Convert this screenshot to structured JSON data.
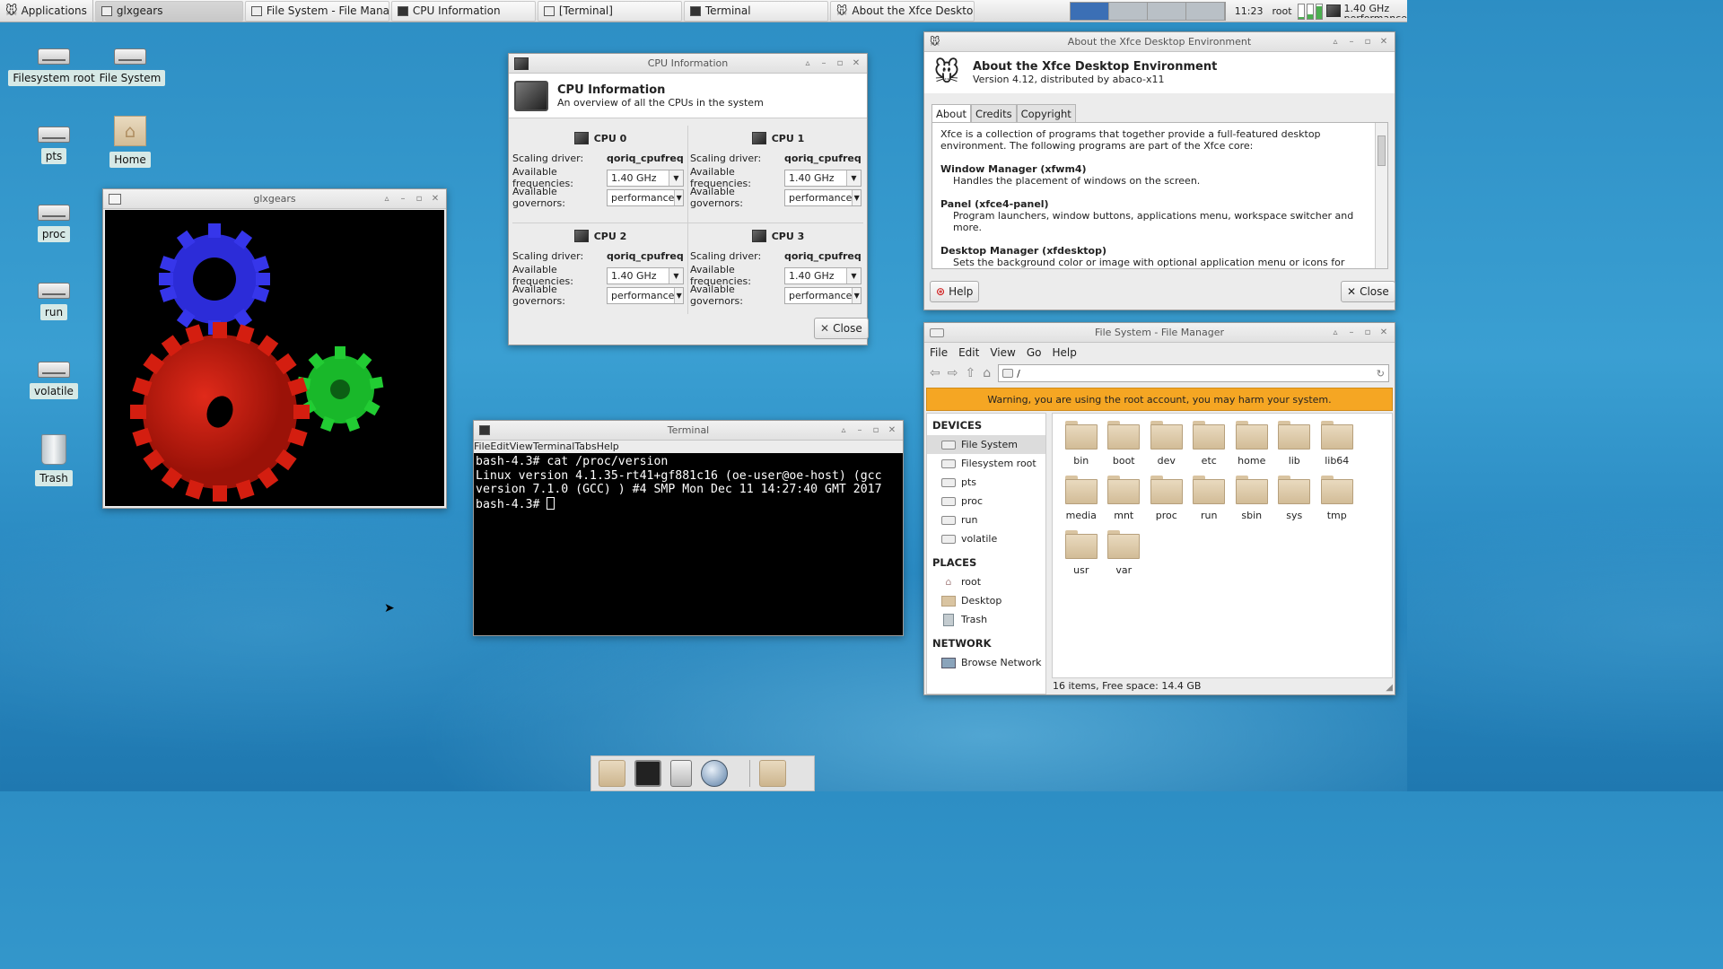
{
  "panel": {
    "applications": "Applications",
    "tasks": [
      {
        "label": "glxgears",
        "active": true
      },
      {
        "label": "File System - File Manager"
      },
      {
        "label": "CPU Information"
      },
      {
        "label": "[Terminal]"
      },
      {
        "label": "Terminal"
      },
      {
        "label": "About the Xfce Desktop E..."
      }
    ],
    "clock": "11:23",
    "user": "root",
    "cpu_freq": "1.40 GHz",
    "cpu_freq_sub": "performance",
    "cpu_levels": [
      0.1,
      0.3,
      0.9
    ]
  },
  "desktop": {
    "icons": [
      "Filesystem root",
      "File System",
      "pts",
      "Home",
      "proc",
      "run",
      "volatile",
      "Trash"
    ]
  },
  "glxgears": {
    "title": "glxgears"
  },
  "cpu_window": {
    "title": "CPU Information",
    "heading": "CPU Information",
    "subheading": "An overview of all the CPUs in the system",
    "labels": {
      "driver": "Scaling driver:",
      "freq": "Available frequencies:",
      "gov": "Available governors:"
    },
    "cpus": [
      {
        "name": "CPU 0",
        "driver": "qoriq_cpufreq",
        "freq": "1.40 GHz",
        "gov": "performance"
      },
      {
        "name": "CPU 1",
        "driver": "qoriq_cpufreq",
        "freq": "1.40 GHz",
        "gov": "performance"
      },
      {
        "name": "CPU 2",
        "driver": "qoriq_cpufreq",
        "freq": "1.40 GHz",
        "gov": "performance"
      },
      {
        "name": "CPU 3",
        "driver": "qoriq_cpufreq",
        "freq": "1.40 GHz",
        "gov": "performance"
      }
    ],
    "close": "Close"
  },
  "terminal": {
    "title": "Terminal",
    "menu": [
      "File",
      "Edit",
      "View",
      "Terminal",
      "Tabs",
      "Help"
    ],
    "lines": [
      "bash-4.3# cat /proc/version",
      "Linux version 4.1.35-rt41+gf881c16 (oe-user@oe-host) (gcc",
      "version 7.1.0 (GCC) ) #4 SMP Mon Dec 11 14:27:40 GMT 2017",
      "bash-4.3# "
    ]
  },
  "about": {
    "title": "About the Xfce Desktop Environment",
    "heading": "About the Xfce Desktop Environment",
    "version": "Version 4.12, distributed by abaco-x11",
    "tabs": [
      "About",
      "Credits",
      "Copyright"
    ],
    "intro": "Xfce is a collection of programs that together provide a full-featured desktop environment. The following programs are part of the Xfce core:",
    "items": [
      {
        "name": "Window Manager (xfwm4)",
        "desc": "Handles the placement of windows on the screen."
      },
      {
        "name": "Panel (xfce4-panel)",
        "desc": "Program launchers, window buttons, applications menu, workspace switcher and more."
      },
      {
        "name": "Desktop Manager (xfdesktop)",
        "desc": "Sets the background color or image with optional application menu or icons for minimized applications or launchers, devices and folders."
      }
    ],
    "help": "Help",
    "close": "Close"
  },
  "file_manager": {
    "title": "File System - File Manager",
    "menu": [
      "File",
      "Edit",
      "View",
      "Go",
      "Help"
    ],
    "path": "/",
    "warning": "Warning, you are using the root account, you may harm your system.",
    "devices_header": "DEVICES",
    "devices": [
      "File System",
      "Filesystem root",
      "pts",
      "proc",
      "run",
      "volatile"
    ],
    "places_header": "PLACES",
    "places": [
      "root",
      "Desktop",
      "Trash"
    ],
    "network_header": "NETWORK",
    "network": [
      "Browse Network"
    ],
    "folders": [
      "bin",
      "boot",
      "dev",
      "etc",
      "home",
      "lib",
      "lib64",
      "media",
      "mnt",
      "proc",
      "run",
      "sbin",
      "sys",
      "tmp",
      "usr",
      "var"
    ],
    "status": "16 items, Free space: 14.4 GB",
    "warning_color": "#f5a623"
  }
}
